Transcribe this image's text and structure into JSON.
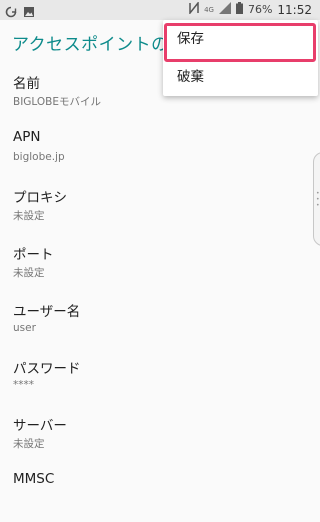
{
  "status_bar": {
    "notification_icons": [
      "sync-icon",
      "image-icon"
    ],
    "nfc_icon": "nfc-icon",
    "network_label": "4G",
    "signal_icon": "signal-icon",
    "battery_icon": "battery-icon",
    "battery_percent": "76%",
    "time": "11:52"
  },
  "app_bar": {
    "title": "アクセスポイントの編"
  },
  "settings": [
    {
      "label": "名前",
      "value": "BIGLOBEモバイル"
    },
    {
      "label": "APN",
      "value": "biglobe.jp"
    },
    {
      "label": "プロキシ",
      "value": "未設定"
    },
    {
      "label": "ポート",
      "value": "未設定"
    },
    {
      "label": "ユーザー名",
      "value": "user"
    },
    {
      "label": "パスワード",
      "value": "****"
    },
    {
      "label": "サーバー",
      "value": "未設定"
    },
    {
      "label": "MMSC",
      "value": ""
    }
  ],
  "menu": {
    "items": [
      {
        "label": "保存"
      },
      {
        "label": "破棄"
      }
    ]
  },
  "colors": {
    "accent": "#0d8b8b",
    "highlight": "#e83e6b",
    "status_bar": "#e8e8e8"
  }
}
